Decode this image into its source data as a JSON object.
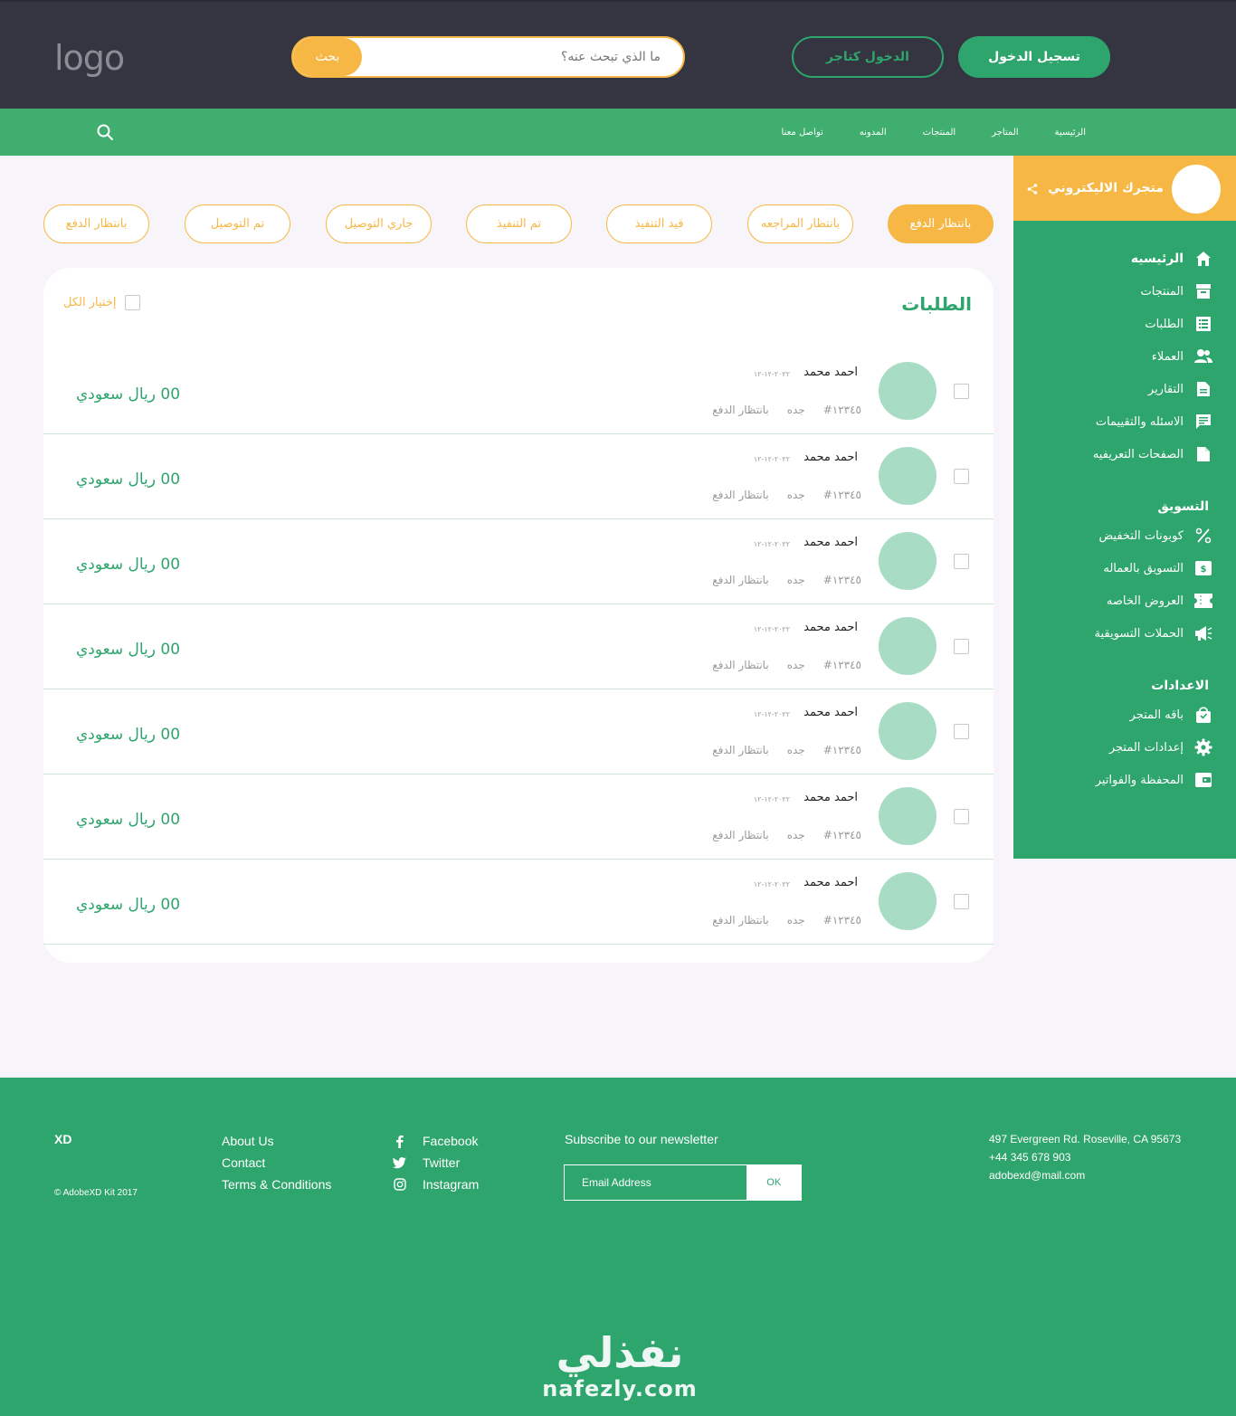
{
  "header": {
    "logo": "logo",
    "search_placeholder": "ما الذي تبحث عنه؟",
    "search_button": "بحث",
    "merchant_login": "الدخول كتاجر",
    "signup": "تسجيل الدخول"
  },
  "nav": {
    "items": [
      "الرئيسية",
      "المتاجر",
      "المنتجات",
      "المدونه",
      "تواصل معنا"
    ]
  },
  "sidebar": {
    "store_name": "متجرك الاليكتروني",
    "main": [
      {
        "label": "الرئيسيه",
        "icon": "home-icon"
      },
      {
        "label": "المنتجات",
        "icon": "archive-icon"
      },
      {
        "label": "الطلبات",
        "icon": "list-icon"
      },
      {
        "label": "العملاء",
        "icon": "users-icon"
      },
      {
        "label": "التقارير",
        "icon": "document-icon"
      },
      {
        "label": "الاسئله والتقييمات",
        "icon": "chat-icon"
      },
      {
        "label": "الصفحات التعريفيه",
        "icon": "pages-icon"
      }
    ],
    "marketing_title": "التسويق",
    "marketing": [
      {
        "label": "كوبونات التخفيض",
        "icon": "percent-icon"
      },
      {
        "label": "التسويق بالعماله",
        "icon": "dollar-icon"
      },
      {
        "label": "العروض الخاصه",
        "icon": "ticket-icon"
      },
      {
        "label": "الحملات التسويقية",
        "icon": "megaphone-icon"
      }
    ],
    "settings_title": "الاعدادات",
    "settings": [
      {
        "label": "باقه المتجر",
        "icon": "bag-icon"
      },
      {
        "label": "إعدادات المتجر",
        "icon": "gear-icon"
      },
      {
        "label": "المحفظة والفواتير",
        "icon": "wallet-icon"
      }
    ]
  },
  "filters": [
    "بانتظار الدفع",
    "بانتظار المراجعه",
    "قيد التنفيذ",
    "تم التنفيذ",
    "جاري التوصيل",
    "تم التوصيل",
    "بانتظار الدفع"
  ],
  "orders": {
    "title": "الطلبات",
    "select_all": "إختيار الكل",
    "rows": [
      {
        "name": "احمد محمد",
        "date": "٢٠٢٢-١٢-١٢",
        "id": "#١٢٣٤٥",
        "city": "جده",
        "status": "بانتظار الدفع",
        "price": "00 ريال سعودي"
      },
      {
        "name": "احمد محمد",
        "date": "٢٠٢٢-١٢-١٢",
        "id": "#١٢٣٤٥",
        "city": "جده",
        "status": "بانتظار الدفع",
        "price": "00 ريال سعودي"
      },
      {
        "name": "احمد محمد",
        "date": "٢٠٢٢-١٢-١٢",
        "id": "#١٢٣٤٥",
        "city": "جده",
        "status": "بانتظار الدفع",
        "price": "00 ريال سعودي"
      },
      {
        "name": "احمد محمد",
        "date": "٢٠٢٢-١٢-١٢",
        "id": "#١٢٣٤٥",
        "city": "جده",
        "status": "بانتظار الدفع",
        "price": "00 ريال سعودي"
      },
      {
        "name": "احمد محمد",
        "date": "٢٠٢٢-١٢-١٢",
        "id": "#١٢٣٤٥",
        "city": "جده",
        "status": "بانتظار الدفع",
        "price": "00 ريال سعودي"
      },
      {
        "name": "احمد محمد",
        "date": "٢٠٢٢-١٢-١٢",
        "id": "#١٢٣٤٥",
        "city": "جده",
        "status": "بانتظار الدفع",
        "price": "00 ريال سعودي"
      },
      {
        "name": "احمد محمد",
        "date": "٢٠٢٢-١٢-١٢",
        "id": "#١٢٣٤٥",
        "city": "جده",
        "status": "بانتظار الدفع",
        "price": "00 ريال سعودي"
      }
    ]
  },
  "footer": {
    "brand": "XD",
    "copyright": "© AdobeXD Kit 2017",
    "links": [
      "About Us",
      "Contact",
      "Terms & Conditions"
    ],
    "social": [
      {
        "label": "Facebook",
        "icon": "facebook-icon"
      },
      {
        "label": "Twitter",
        "icon": "twitter-icon"
      },
      {
        "label": "Instagram",
        "icon": "instagram-icon"
      }
    ],
    "newsletter_title": "Subscribe to our newsletter",
    "email_placeholder": "Email Address",
    "ok": "OK",
    "address": [
      "497 Evergreen Rd. Roseville, CA 95673",
      "+44 345 678 903",
      "adobexd@mail.com"
    ],
    "watermark_ar": "نفذلي",
    "watermark_en": "nafezly.com"
  },
  "colors": {
    "green": "#2ea56d",
    "nav_green": "#3fae6e",
    "orange": "#f7b744",
    "dark": "#353541",
    "avatar": "#a9dcc4"
  }
}
